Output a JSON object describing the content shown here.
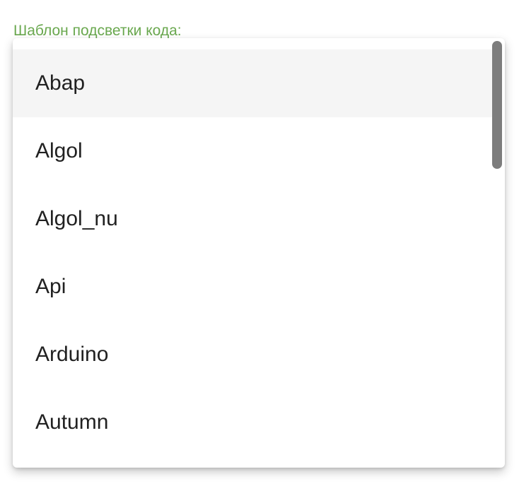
{
  "field": {
    "label": "Шаблон подсветки кода:",
    "label_color": "#6aa84f"
  },
  "dropdown": {
    "highlighted_index": 0,
    "options": [
      "Abap",
      "Algol",
      "Algol_nu",
      "Api",
      "Arduino",
      "Autumn"
    ]
  }
}
